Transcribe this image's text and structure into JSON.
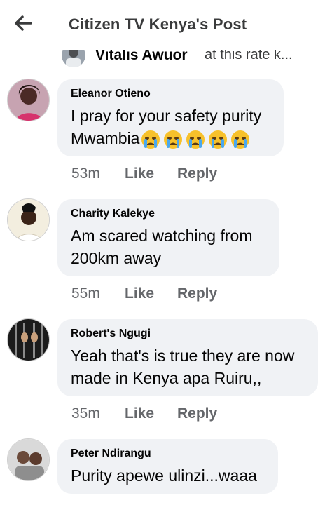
{
  "header": {
    "title": "Citizen TV Kenya's Post",
    "back_icon": "back-arrow-icon"
  },
  "reply_peek": {
    "name": "Vitalis Awuor",
    "text": "at this rate k..."
  },
  "comments": [
    {
      "author": "Eleanor Otieno",
      "text": "I pray for your safety purity Mwambia",
      "emojis": [
        "crying-face",
        "crying-face",
        "crying-face",
        "crying-face",
        "crying-face"
      ],
      "time": "53m",
      "like_label": "Like",
      "reply_label": "Reply"
    },
    {
      "author": "Charity Kalekye",
      "text_line1": "Am scared watching from",
      "text_line2": "200km away",
      "time": "55m",
      "like_label": "Like",
      "reply_label": "Reply"
    },
    {
      "author": "Robert's Ngugi",
      "text_line1": "Yeah that's is true they are now",
      "text_line2": "made in Kenya apa Ruiru,,",
      "time": "35m",
      "like_label": "Like",
      "reply_label": "Reply"
    },
    {
      "author": "Peter Ndirangu",
      "text": "Purity apewe ulinzi...waaa"
    }
  ],
  "colors": {
    "bubble": "#f0f2f5",
    "meta_text": "#65676b",
    "header_text": "#3a3b3c"
  }
}
